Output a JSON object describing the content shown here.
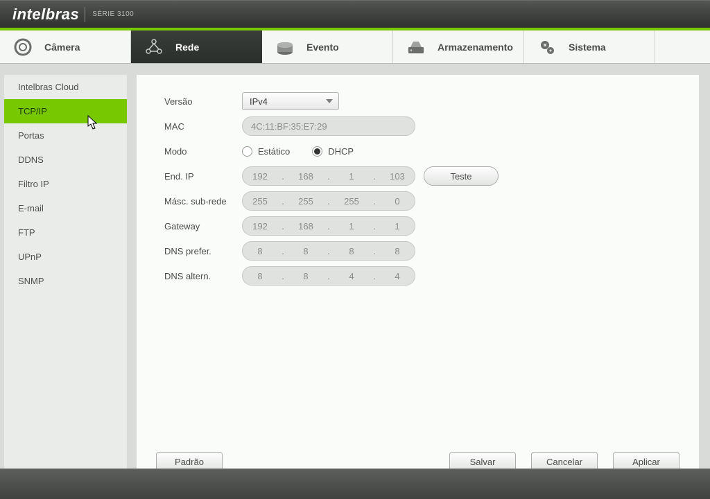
{
  "header": {
    "brand": "intelbras",
    "series": "SÉRIE 3100"
  },
  "nav": {
    "camera": "Câmera",
    "rede": "Rede",
    "evento": "Evento",
    "armazenamento": "Armazenamento",
    "sistema": "Sistema"
  },
  "sidebar": {
    "items": [
      "Intelbras Cloud",
      "TCP/IP",
      "Portas",
      "DDNS",
      "Filtro IP",
      "E-mail",
      "FTP",
      "UPnP",
      "SNMP"
    ],
    "active_index": 1
  },
  "form": {
    "labels": {
      "versao": "Versão",
      "mac": "MAC",
      "modo": "Modo",
      "end_ip": "End. IP",
      "mascara": "Másc. sub-rede",
      "gateway": "Gateway",
      "dns_prefer": "DNS prefer.",
      "dns_altern": "DNS altern."
    },
    "versao_value": "IPv4",
    "mac_value": "4C:11:BF:35:E7:29",
    "modo": {
      "option_static": "Estático",
      "option_dhcp": "DHCP",
      "selected": "dhcp"
    },
    "ip": [
      "192",
      "168",
      "1",
      "103"
    ],
    "mask": [
      "255",
      "255",
      "255",
      "0"
    ],
    "gateway": [
      "192",
      "168",
      "1",
      "1"
    ],
    "dns_pref": [
      "8",
      "8",
      "8",
      "8"
    ],
    "dns_alt": [
      "8",
      "8",
      "4",
      "4"
    ],
    "test_btn": "Teste"
  },
  "buttons": {
    "padrao": "Padrão",
    "salvar": "Salvar",
    "cancelar": "Cancelar",
    "aplicar": "Aplicar"
  }
}
